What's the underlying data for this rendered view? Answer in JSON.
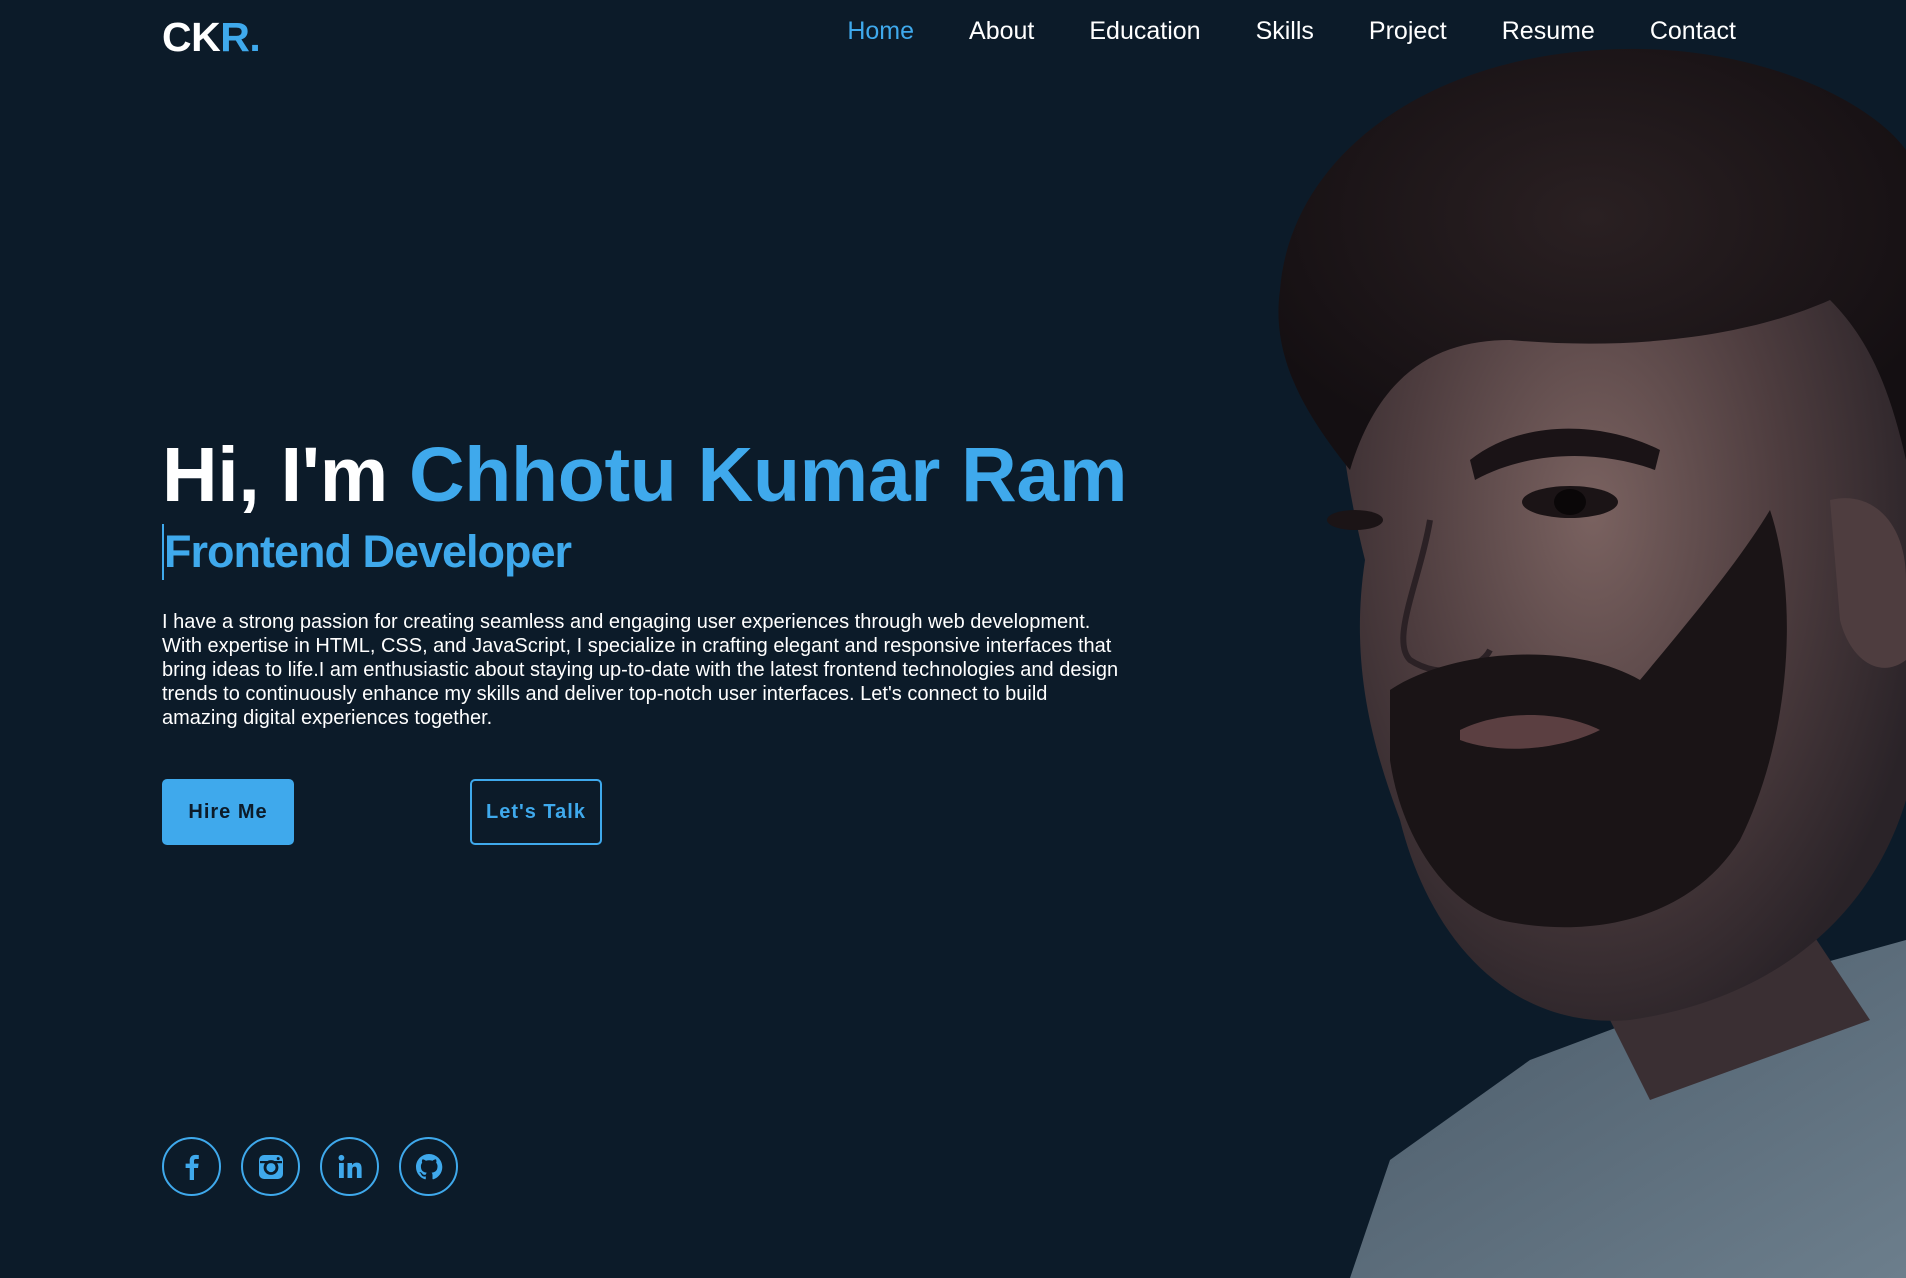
{
  "brand": {
    "logo_main": "CK",
    "logo_accent": "R."
  },
  "nav": {
    "items": [
      {
        "label": "Home",
        "active": true
      },
      {
        "label": "About",
        "active": false
      },
      {
        "label": "Education",
        "active": false
      },
      {
        "label": "Skills",
        "active": false
      },
      {
        "label": "Project",
        "active": false
      },
      {
        "label": "Resume",
        "active": false
      },
      {
        "label": "Contact",
        "active": false
      }
    ]
  },
  "hero": {
    "greeting": "Hi, I'm ",
    "name": "Chhotu Kumar Ram",
    "role": "Frontend Developer",
    "description": "I have a strong passion for creating seamless and engaging user experiences through web development. With expertise in HTML, CSS, and JavaScript, I specialize in crafting elegant and responsive interfaces that bring ideas to life.I am enthusiastic about staying up-to-date with the latest frontend technologies and design trends to continuously enhance my skills and deliver top-notch user interfaces. Let's connect to build amazing digital experiences together."
  },
  "buttons": {
    "hire": "Hire Me",
    "talk": "Let's Talk"
  },
  "socials": [
    "facebook-icon",
    "instagram-icon",
    "linkedin-icon",
    "github-icon"
  ],
  "colors": {
    "background": "#0c1b29",
    "accent": "#3fa9ec",
    "text": "#ffffff"
  }
}
